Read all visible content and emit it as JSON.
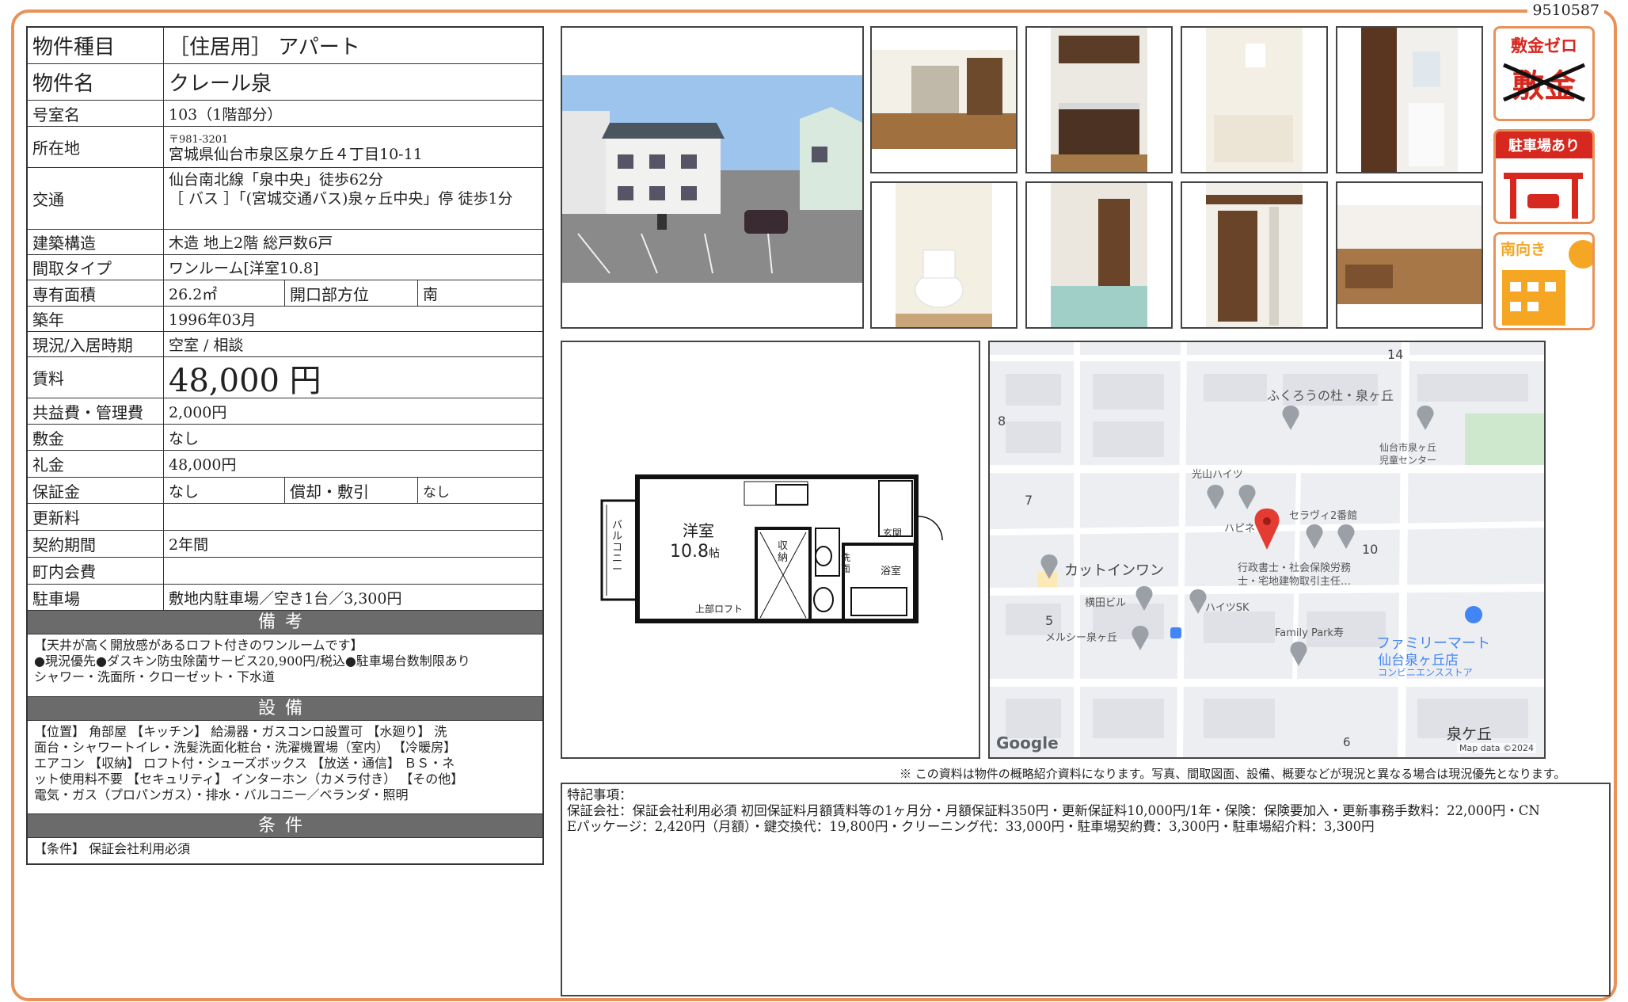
{
  "doc_id": "9510587",
  "property": {
    "type_label": "物件種目",
    "type_value": "［住居用］ アパート",
    "name_label": "物件名",
    "name_value": "クレール泉",
    "room_label": "号室名",
    "room_value": "103（1階部分）",
    "address_label": "所在地",
    "postal": "〒981-3201",
    "address_value": "宮城県仙台市泉区泉ケ丘４丁目10-11",
    "traffic_label": "交通",
    "traffic_1": "仙台南北線「泉中央」徒歩62分",
    "traffic_2": "［ バス ］「(宮城交通バス)泉ヶ丘中央」停 徒歩1分",
    "structure_label": "建築構造",
    "structure_value": "木造 地上2階 総戸数6戸",
    "layout_label": "間取タイプ",
    "layout_value": "ワンルーム[洋室10.8]",
    "area_label": "専有面積",
    "area_value": "26.2㎡",
    "direction_label": "開口部方位",
    "direction_value": "南",
    "built_label": "築年",
    "built_value": "1996年03月",
    "status_label": "現況/入居時期",
    "status_value": "空室 / 相談",
    "rent_label": "賃料",
    "rent_value": "48,000 円",
    "fee_label": "共益費・管理費",
    "fee_value": "2,000円",
    "deposit_label": "敷金",
    "deposit_value": "なし",
    "key_money_label": "礼金",
    "key_money_value": "48,000円",
    "guarantee_label": "保証金",
    "guarantee_value": "なし",
    "amort_label": "償却・敷引",
    "amort_value": "なし",
    "renewal_label": "更新料",
    "renewal_value": "",
    "contract_label": "契約期間",
    "contract_value": "2年間",
    "assoc_label": "町内会費",
    "assoc_value": "",
    "parking_label": "駐車場",
    "parking_value": "敷地内駐車場／空き1台／3,300円"
  },
  "remarks": {
    "header": "備考",
    "lines": [
      "【天井が高く開放感があるロフト付きのワンルームです】",
      "●現況優先●ダスキン防虫除菌サービス20,900円/税込●駐車場台数制限あり",
      "シャワー・洗面所・クローゼット・下水道"
    ]
  },
  "facilities": {
    "header": "設備",
    "lines": [
      "【位置】 角部屋 【キッチン】 給湯器・ガスコンロ設置可 【水廻り】 洗",
      "面台・シャワートイレ・洗髪洗面化粧台・洗濯機置場（室内） 【冷暖房】",
      "エアコン 【収納】 ロフト付・シューズボックス 【放送・通信】 ＢＳ・ネ",
      "ット使用料不要 【セキュリティ】 インターホン（カメラ付き） 【その他】",
      "電気・ガス（プロパンガス）・排水・バルコニー／ベランダ・照明"
    ]
  },
  "conditions": {
    "header": "条件",
    "lines": [
      "【条件】 保証会社利用必須"
    ]
  },
  "badges": {
    "deposit_zero": {
      "title": "敷金ゼロ",
      "crossed": "敷金"
    },
    "parking": {
      "title": "駐車場あり"
    },
    "south": {
      "title": "南向き"
    }
  },
  "floorplan": {
    "room_name": "洋室",
    "room_size": "10.8",
    "room_unit": "帖",
    "balcony": "バルコニー",
    "storage": "収納",
    "washroom": "洗面",
    "entrance": "玄関",
    "bath": "浴室",
    "loft": "上部ロフト"
  },
  "map": {
    "labels": [
      "14",
      "ふくろうの杜・泉ヶ丘",
      "8",
      "仙台市泉ヶ丘",
      "児童センター",
      "光山ハイツ",
      "7",
      "ハピネ",
      "セラヴィ2番館",
      "10",
      "行政書士・社会保険労務",
      "士・宅地建物取引主任…",
      "カットインワン",
      "横田ビル",
      "ハイツSK",
      "5",
      "メルシー泉ヶ丘",
      "Family Park寿",
      "ファミリーマート",
      "仙台泉ヶ丘店",
      "コンビニエンスストア",
      "泉ケ丘",
      "6"
    ],
    "google": "Google",
    "credit": "Map data ©2024"
  },
  "disclaimer": "※ この資料は物件の概略紹介資料になります。写真、間取図面、設備、概要などが現況と異なる場合は現況優先となります。",
  "special": {
    "title": "特記事項：",
    "line1": "保証会社：保証会社利用必須 初回保証料月額賃料等の1ヶ月分・月額保証料350円・更新保証料10,000円/1年・保険：保険要加入・更新事務手数料：22,000円・CN",
    "line2": "Eパッケージ：2,420円（月額）・鍵交換代：19,800円・クリーニング代：33,000円・駐車場契約費：3,300円・駐車場紹介料：3,300円"
  },
  "colors": {
    "accent": "#e8925a",
    "section": "#6b6b6b",
    "badge_red": "#d6281f",
    "badge_orange": "#f5a623"
  }
}
